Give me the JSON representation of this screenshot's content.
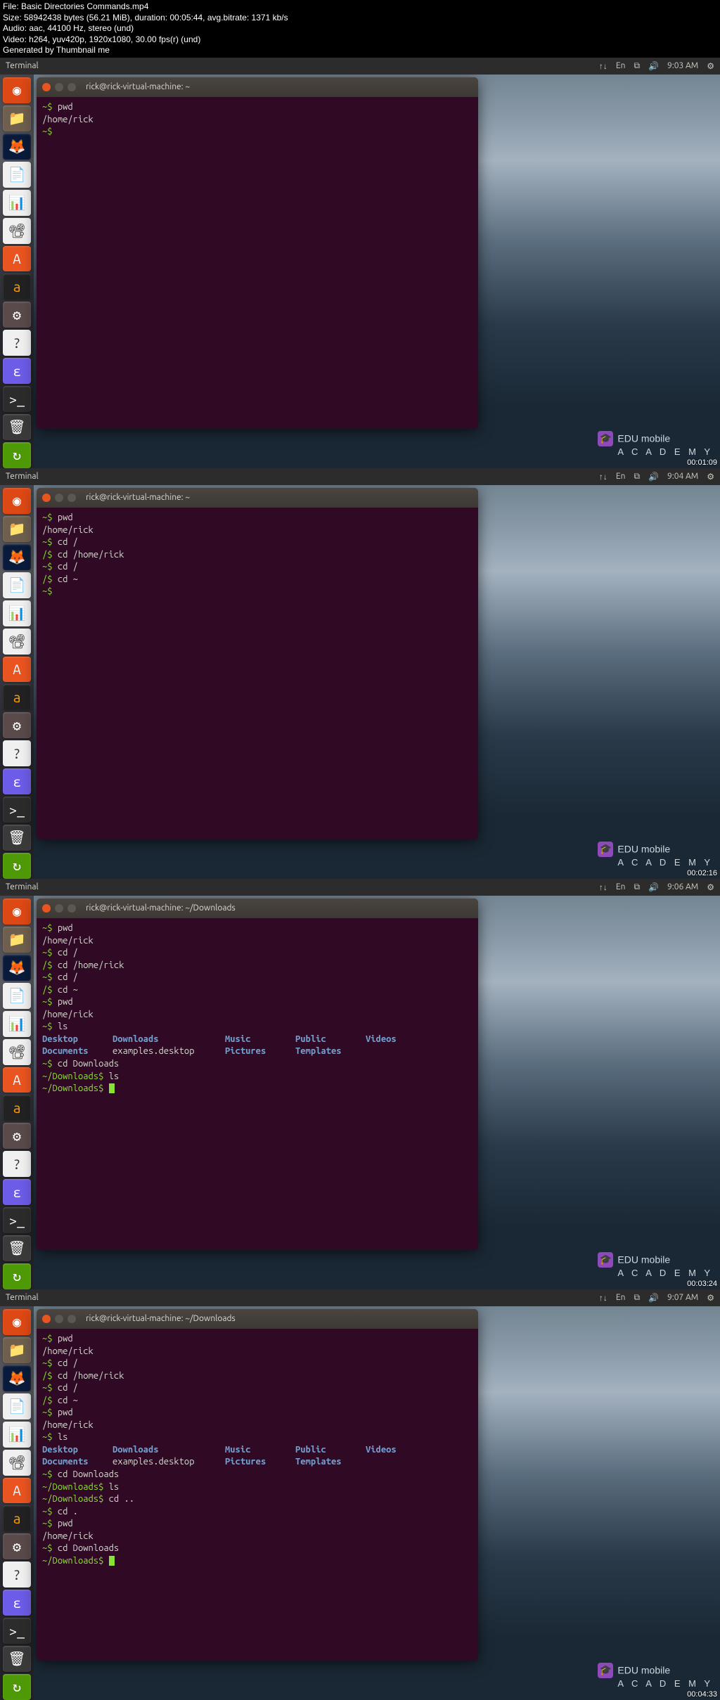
{
  "file_info": {
    "file": "File: Basic Directories Commands.mp4",
    "size": "Size: 58942438 bytes (56.21 MiB), duration: 00:05:44, avg.bitrate: 1371 kb/s",
    "audio": "Audio: aac, 44100 Hz, stereo (und)",
    "video": "Video: h264, yuv420p, 1920x1080, 30.00 fps(r) (und)",
    "gen": "Generated by Thumbnail me"
  },
  "topbar_title": "Terminal",
  "indicators": [
    "↑↓",
    "En",
    "⧉",
    "🔊"
  ],
  "dock_items": [
    {
      "name": "dash",
      "bg": "#dd4814",
      "glyph": "◉"
    },
    {
      "name": "files",
      "bg": "#6e5f4e",
      "glyph": "📁"
    },
    {
      "name": "firefox",
      "bg": "#0a1a3a",
      "glyph": "🦊"
    },
    {
      "name": "writer",
      "bg": "#f0f0f0",
      "glyph": "📄"
    },
    {
      "name": "calc",
      "bg": "#f0f0f0",
      "glyph": "📊"
    },
    {
      "name": "impress",
      "bg": "#f0f0f0",
      "glyph": "📽"
    },
    {
      "name": "software",
      "bg": "#e95420",
      "glyph": "A"
    },
    {
      "name": "amazon",
      "bg": "#222222",
      "glyph": "a"
    },
    {
      "name": "settings",
      "bg": "#5a4a4a",
      "glyph": "⚙"
    },
    {
      "name": "help",
      "bg": "#f0f0f0",
      "glyph": "?"
    },
    {
      "name": "emacs",
      "bg": "#6c5ce7",
      "glyph": "ε"
    },
    {
      "name": "terminal",
      "bg": "#2c2c2c",
      "glyph": ">_"
    },
    {
      "name": "trash",
      "bg": "#3a3a3a",
      "glyph": "🗑"
    },
    {
      "name": "updates",
      "bg": "#4e9a06",
      "glyph": "↻"
    }
  ],
  "watermark": {
    "top": "EDU mobile",
    "bottom": "A C A D E M Y"
  },
  "frames": [
    {
      "time": "9:03 AM",
      "timecode": "00:01:09",
      "title": "rick@rick-virtual-machine: ~",
      "lines": [
        {
          "t": "cmd",
          "prompt": "~$ ",
          "txt": "pwd"
        },
        {
          "t": "out",
          "txt": "/home/rick"
        },
        {
          "t": "promptonly",
          "prompt": "~$ "
        }
      ]
    },
    {
      "time": "9:04 AM",
      "timecode": "00:02:16",
      "title": "rick@rick-virtual-machine: ~",
      "lines": [
        {
          "t": "cmd",
          "prompt": "~$ ",
          "txt": "pwd"
        },
        {
          "t": "out",
          "txt": "/home/rick"
        },
        {
          "t": "cmd",
          "prompt": "~$ ",
          "txt": "cd /"
        },
        {
          "t": "cmd",
          "prompt": "/$ ",
          "txt": "cd /home/rick"
        },
        {
          "t": "cmd",
          "prompt": "~$ ",
          "txt": "cd /"
        },
        {
          "t": "cmd",
          "prompt": "/$ ",
          "txt": "cd ~"
        },
        {
          "t": "promptonly",
          "prompt": "~$ "
        }
      ]
    },
    {
      "time": "9:06 AM",
      "timecode": "00:03:24",
      "title": "rick@rick-virtual-machine: ~/Downloads",
      "lines": [
        {
          "t": "cmd",
          "prompt": "~$ ",
          "txt": "pwd"
        },
        {
          "t": "out",
          "txt": "/home/rick"
        },
        {
          "t": "cmd",
          "prompt": "~$ ",
          "txt": "cd /"
        },
        {
          "t": "cmd",
          "prompt": "/$ ",
          "txt": "cd /home/rick"
        },
        {
          "t": "cmd",
          "prompt": "~$ ",
          "txt": "cd /"
        },
        {
          "t": "cmd",
          "prompt": "/$ ",
          "txt": "cd ~"
        },
        {
          "t": "cmd",
          "prompt": "~$ ",
          "txt": "pwd"
        },
        {
          "t": "out",
          "txt": "/home/rick"
        },
        {
          "t": "cmd",
          "prompt": "~$ ",
          "txt": "ls"
        },
        {
          "t": "ls",
          "row": [
            "Desktop",
            "Downloads",
            "Music",
            "Public",
            "Videos"
          ],
          "types": [
            "d",
            "d",
            "d",
            "d",
            "d"
          ]
        },
        {
          "t": "ls",
          "row": [
            "Documents",
            "examples.desktop",
            "Pictures",
            "Templates",
            ""
          ],
          "types": [
            "d",
            "f",
            "d",
            "d",
            ""
          ]
        },
        {
          "t": "cmd",
          "prompt": "~$ ",
          "txt": "cd Downloads"
        },
        {
          "t": "cmd",
          "prompt": "~/Downloads$ ",
          "txt": "ls"
        },
        {
          "t": "cursor",
          "prompt": "~/Downloads$ "
        }
      ]
    },
    {
      "time": "9:07 AM",
      "timecode": "00:04:33",
      "title": "rick@rick-virtual-machine: ~/Downloads",
      "lines": [
        {
          "t": "cmd",
          "prompt": "~$ ",
          "txt": "pwd"
        },
        {
          "t": "out",
          "txt": "/home/rick"
        },
        {
          "t": "cmd",
          "prompt": "~$ ",
          "txt": "cd /"
        },
        {
          "t": "cmd",
          "prompt": "/$ ",
          "txt": "cd /home/rick"
        },
        {
          "t": "cmd",
          "prompt": "~$ ",
          "txt": "cd /"
        },
        {
          "t": "cmd",
          "prompt": "/$ ",
          "txt": "cd ~"
        },
        {
          "t": "cmd",
          "prompt": "~$ ",
          "txt": "pwd"
        },
        {
          "t": "out",
          "txt": "/home/rick"
        },
        {
          "t": "cmd",
          "prompt": "~$ ",
          "txt": "ls"
        },
        {
          "t": "ls",
          "row": [
            "Desktop",
            "Downloads",
            "Music",
            "Public",
            "Videos"
          ],
          "types": [
            "d",
            "d",
            "d",
            "d",
            "d"
          ]
        },
        {
          "t": "ls",
          "row": [
            "Documents",
            "examples.desktop",
            "Pictures",
            "Templates",
            ""
          ],
          "types": [
            "d",
            "f",
            "d",
            "d",
            ""
          ]
        },
        {
          "t": "cmd",
          "prompt": "~$ ",
          "txt": "cd Downloads"
        },
        {
          "t": "cmd",
          "prompt": "~/Downloads$ ",
          "txt": "ls"
        },
        {
          "t": "cmd",
          "prompt": "~/Downloads$ ",
          "txt": "cd .."
        },
        {
          "t": "cmd",
          "prompt": "~$ ",
          "txt": "cd ."
        },
        {
          "t": "cmd",
          "prompt": "~$ ",
          "txt": "pwd"
        },
        {
          "t": "out",
          "txt": "/home/rick"
        },
        {
          "t": "cmd",
          "prompt": "~$ ",
          "txt": "cd Downloads"
        },
        {
          "t": "cursor",
          "prompt": "~/Downloads$ "
        }
      ]
    }
  ]
}
